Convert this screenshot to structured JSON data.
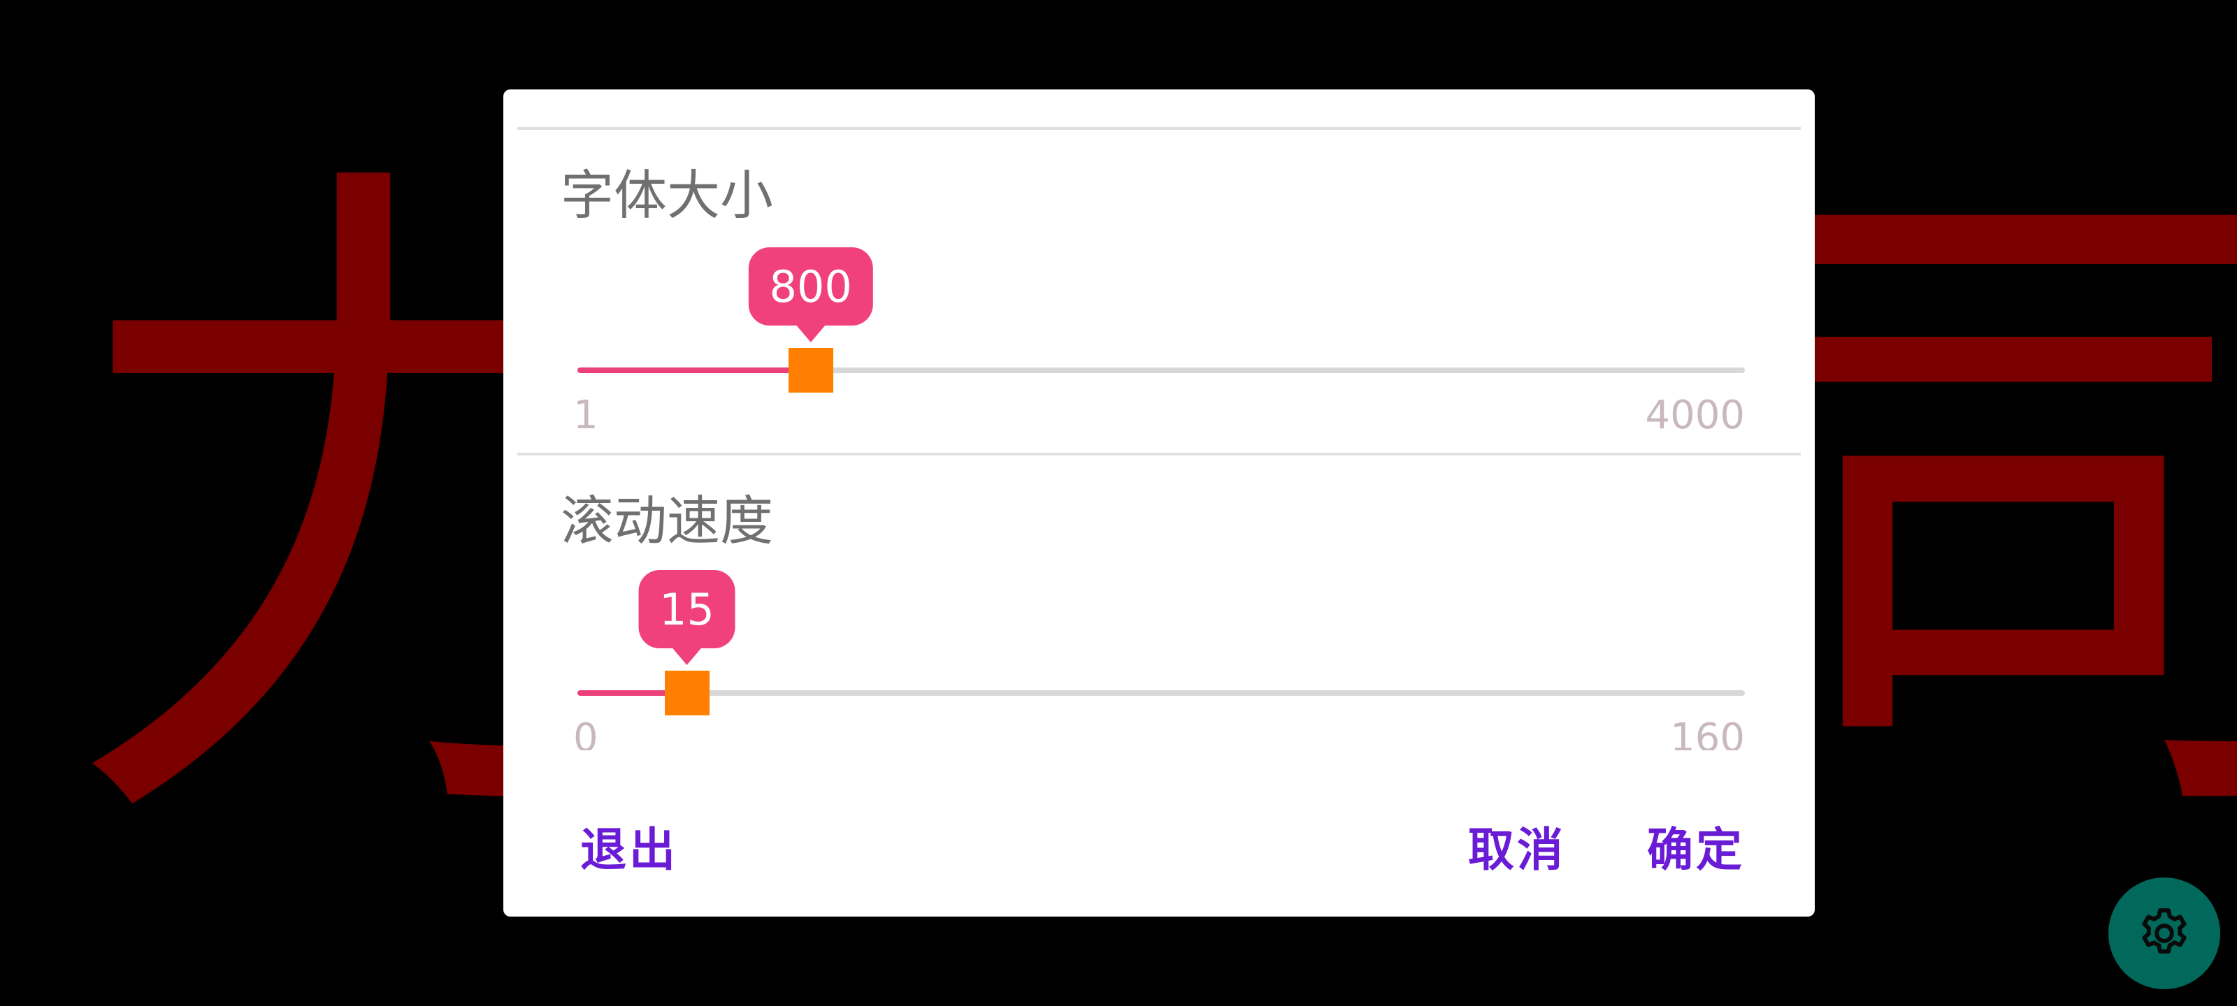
{
  "background_text": {
    "left_chars": "力旦",
    "right_chars": "司丈"
  },
  "dialog": {
    "font_size": {
      "label": "字体大小",
      "value": 800,
      "value_label": "800",
      "min": "1",
      "max": "4000",
      "fraction": 0.1998
    },
    "scroll_speed": {
      "label": "滚动速度",
      "value": 15,
      "value_label": "15",
      "min": "0",
      "max": "160",
      "fraction": 0.09375
    },
    "buttons": {
      "exit": "退出",
      "cancel": "取消",
      "confirm": "确定"
    }
  },
  "fab": {
    "icon": "gear-icon"
  },
  "colors": {
    "accent_pink": "#f0417d",
    "thumb_orange": "#ff8000",
    "button_purple": "#6a1bd6",
    "fab_teal": "#00695c",
    "background_text_red": "#7a0000"
  }
}
